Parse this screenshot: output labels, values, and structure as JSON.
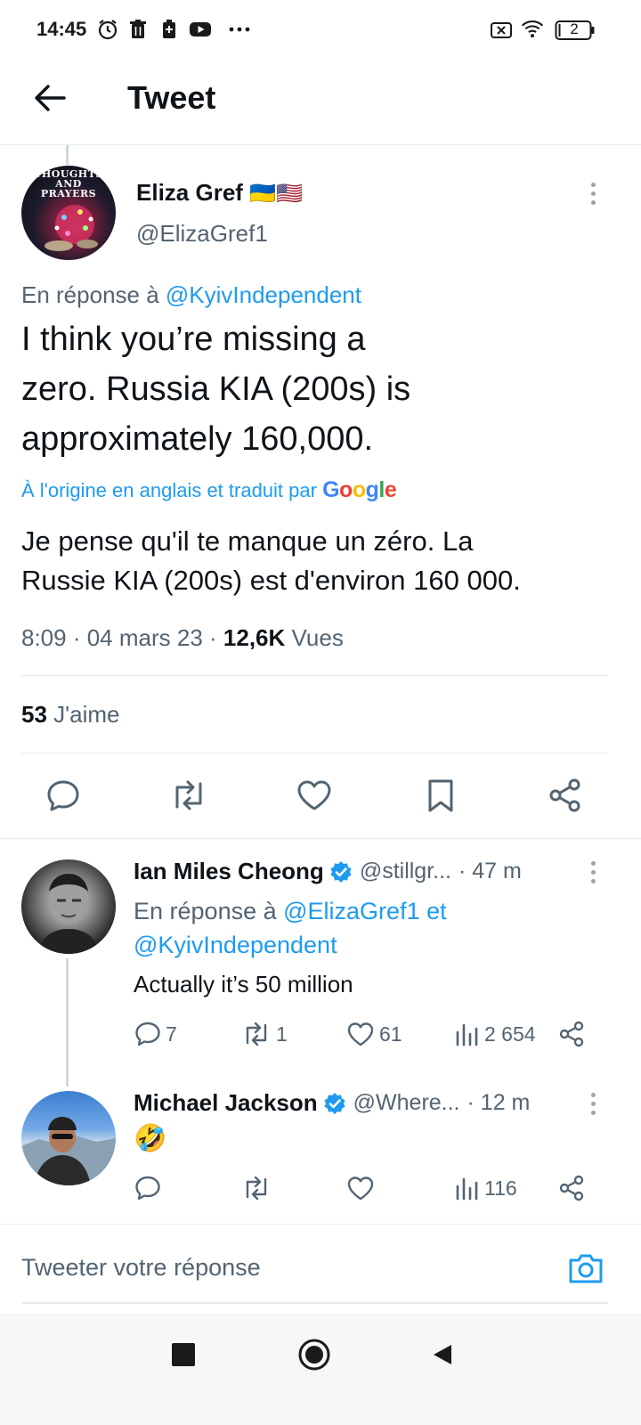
{
  "status_bar": {
    "time": "14:45",
    "icons": [
      "alarm-icon",
      "trash-icon",
      "battery-saver-icon",
      "youtube-icon",
      "more-dots-icon",
      "no-sim-icon",
      "wifi-icon",
      "battery-icon"
    ],
    "battery_level": "2"
  },
  "header": {
    "title": "Tweet",
    "back_icon": "back-arrow-icon"
  },
  "main_tweet": {
    "author_name": "Eliza Gref",
    "author_flags": "🇺🇦🇺🇸",
    "author_handle": "@ElizaGref1",
    "avatar_text": "THOUGHTS AND PRAYERS",
    "reply_prefix": "En réponse à ",
    "reply_to": "@KyivIndependent",
    "text_line1": "I think you’re missing a",
    "text_line2": "zero. Russia KIA (200s) is",
    "text_line3": "approximately 160,000.",
    "translation_label": "À l'origine en anglais et traduit par",
    "translation_brand": "Google",
    "translated_line1": "Je pense qu'il te manque un zéro. La",
    "translated_line2": "Russie KIA (200s) est d'environ 160 000.",
    "time": "8:09",
    "date": "04 mars 23",
    "views_count": "12,6K",
    "views_label": "Vues",
    "likes_count": "53",
    "likes_label": "J'aime"
  },
  "replies": [
    {
      "author_name": "Ian Miles Cheong",
      "verified": true,
      "author_handle": "@stillgr...",
      "time_ago": "· 47 m",
      "reply_prefix": "En réponse à ",
      "reply_to_1": "@ElizaGref1",
      "reply_joiner": " et",
      "reply_to_2": "@KyivIndependent",
      "text": "Actually it’s 50 million",
      "reply_count": "7",
      "retweet_count": "1",
      "like_count": "61",
      "view_count": "2 654"
    },
    {
      "author_name": "Michael Jackson",
      "verified": true,
      "author_handle": "@Where...",
      "time_ago": "· 12 m",
      "text": "🤣",
      "reply_count": "",
      "retweet_count": "",
      "like_count": "",
      "view_count": "116"
    }
  ],
  "compose": {
    "placeholder": "Tweeter votre réponse"
  },
  "nav_bar": {
    "buttons": [
      "recents-button",
      "home-button",
      "back-button"
    ]
  },
  "colors": {
    "accent": "#1d9bf0",
    "text": "#0f1419",
    "muted": "#536471"
  }
}
